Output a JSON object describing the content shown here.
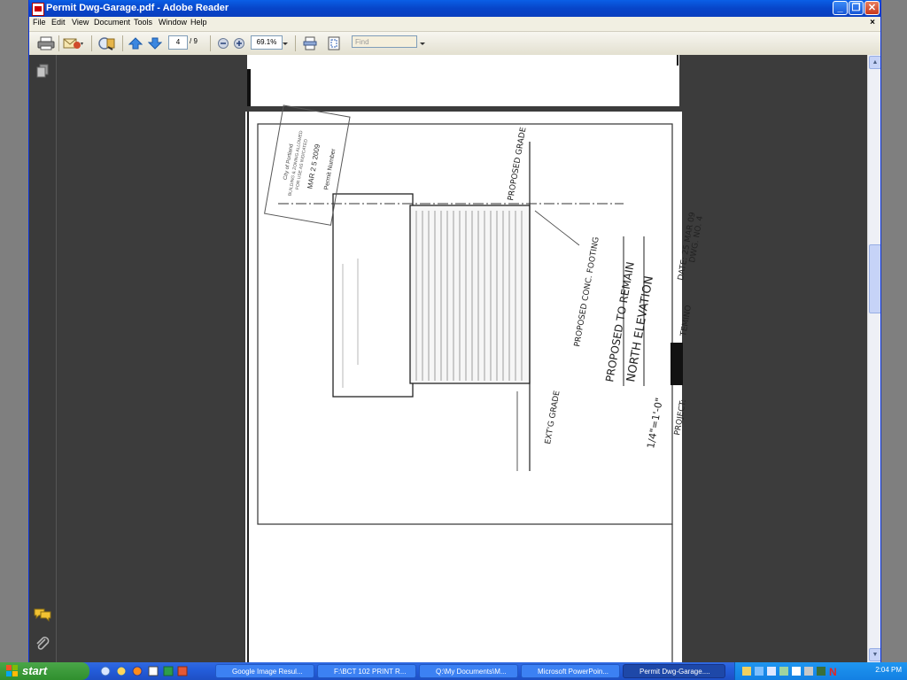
{
  "window": {
    "title": "Permit Dwg-Garage.pdf - Adobe Reader",
    "controls": {
      "minimize": "_",
      "restore": "❐",
      "close": "✕"
    }
  },
  "menu": {
    "items": [
      "File",
      "Edit",
      "View",
      "Document",
      "Tools",
      "Window",
      "Help"
    ],
    "close": "×"
  },
  "toolbar": {
    "page_current": "4",
    "page_total": "/ 9",
    "zoom": "69.1%",
    "find_placeholder": "Find"
  },
  "drawing": {
    "stamp_lines": [
      "City of Portland",
      "BUILDING & ZONING ALLOWED",
      "FOR USE AS INDICATED"
    ],
    "stamp_date": "MAR 2 5 2009",
    "stamp_permit": "Permit Number",
    "label_proposed_grade": "PROPOSED GRADE",
    "label_footing": "PROPOSED CONC. FOOTING",
    "label_ext_grade": "EXT'G GRADE",
    "label_to_remain": "PROPOSED TO REMAIN",
    "label_elevation": "NORTH ELEVATION",
    "label_scale": "1/4\"=1'-0\"",
    "label_project": "PROJECT:",
    "label_project_suffix": "TEMINO",
    "label_date": "DATE: 25 MAR 09",
    "label_dwg": "DWG. NO. 4"
  },
  "taskbar": {
    "start": "start",
    "tasks": [
      "Google Image Resul...",
      "F:\\BCT 102 PRINT R...",
      "Q:\\My Documents\\M...",
      "Microsoft PowerPoin...",
      "Permit Dwg-Garage...."
    ],
    "clock": "2:04 PM"
  },
  "icons": {
    "print": "printer-icon",
    "email": "email-icon",
    "search": "search-icon",
    "prev": "previous-page-icon",
    "next": "next-page-icon",
    "zoom_out": "zoom-out-icon",
    "zoom_in": "zoom-in-icon",
    "fit_page": "fit-page-icon",
    "fit_width": "fit-width-icon"
  }
}
